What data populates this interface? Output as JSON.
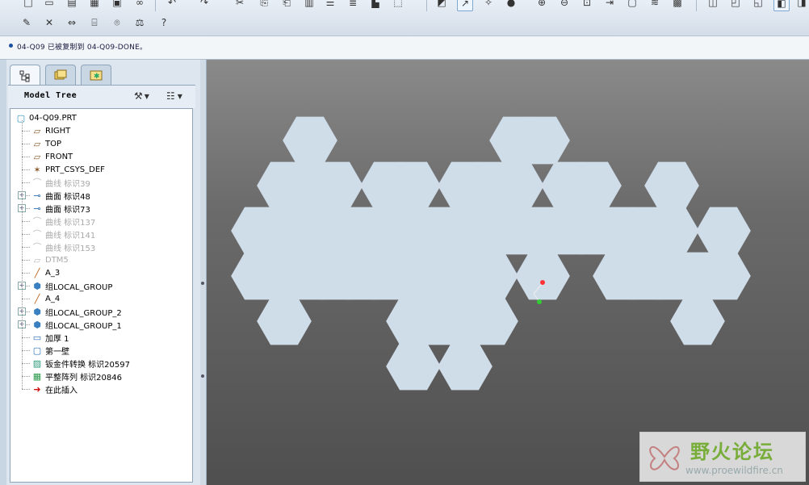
{
  "message": {
    "text": "04-Q09 已被复制到 04-Q09-DONE。"
  },
  "tabs": [
    {
      "name": "model-tree",
      "selected": true
    },
    {
      "name": "folder-browser",
      "selected": false
    },
    {
      "name": "favorites",
      "selected": false
    }
  ],
  "model_tree": {
    "title": "Model Tree",
    "items": [
      {
        "label": "04-Q09.PRT",
        "icon": "part-icon",
        "dim": false,
        "expandable": false
      },
      {
        "label": "RIGHT",
        "icon": "datum-plane-icon",
        "dim": false,
        "expandable": false
      },
      {
        "label": "TOP",
        "icon": "datum-plane-icon",
        "dim": false,
        "expandable": false
      },
      {
        "label": "FRONT",
        "icon": "datum-plane-icon",
        "dim": false,
        "expandable": false
      },
      {
        "label": "PRT_CSYS_DEF",
        "icon": "csys-icon",
        "dim": false,
        "expandable": false
      },
      {
        "label": "曲线 标识39",
        "icon": "curve-icon",
        "dim": true,
        "expandable": false
      },
      {
        "label": "曲面 标识48",
        "icon": "surface-icon",
        "dim": false,
        "expandable": true
      },
      {
        "label": "曲面 标识73",
        "icon": "surface-icon",
        "dim": false,
        "expandable": true
      },
      {
        "label": "曲线 标识137",
        "icon": "curve-icon",
        "dim": true,
        "expandable": false
      },
      {
        "label": "曲线 标识141",
        "icon": "curve-icon",
        "dim": true,
        "expandable": false
      },
      {
        "label": "曲线 标识153",
        "icon": "curve-icon",
        "dim": true,
        "expandable": false
      },
      {
        "label": "DTM5",
        "icon": "datum-plane-icon",
        "dim": true,
        "expandable": false
      },
      {
        "label": "A_3",
        "icon": "axis-icon",
        "dim": false,
        "expandable": false
      },
      {
        "label": "组LOCAL_GROUP",
        "icon": "group-icon",
        "dim": false,
        "expandable": true
      },
      {
        "label": "A_4",
        "icon": "axis-icon",
        "dim": false,
        "expandable": false
      },
      {
        "label": "组LOCAL_GROUP_2",
        "icon": "group-icon",
        "dim": false,
        "expandable": true
      },
      {
        "label": "组LOCAL_GROUP_1",
        "icon": "group-icon",
        "dim": false,
        "expandable": true
      },
      {
        "label": "加厚 1",
        "icon": "thicken-icon",
        "dim": false,
        "expandable": false
      },
      {
        "label": "第一壁",
        "icon": "wall-icon",
        "dim": false,
        "expandable": false
      },
      {
        "label": "钣金件转换 标识20597",
        "icon": "sheetmetal-convert-icon",
        "dim": false,
        "expandable": false
      },
      {
        "label": "平整阵列 标识20846",
        "icon": "flatten-pattern-icon",
        "dim": false,
        "expandable": false
      },
      {
        "label": "在此插入",
        "icon": "insert-here-arrow-icon",
        "dim": false,
        "expandable": false
      }
    ]
  },
  "viewport": {
    "background": [
      "#8a8a8a",
      "#4f4f4f"
    ],
    "part_color": "#cfdde9",
    "csys_colors": {
      "x": "#ff3333",
      "y": "#33cc33"
    }
  },
  "watermark": {
    "title": "野火论坛",
    "url": "www.proewildfire.cn"
  }
}
